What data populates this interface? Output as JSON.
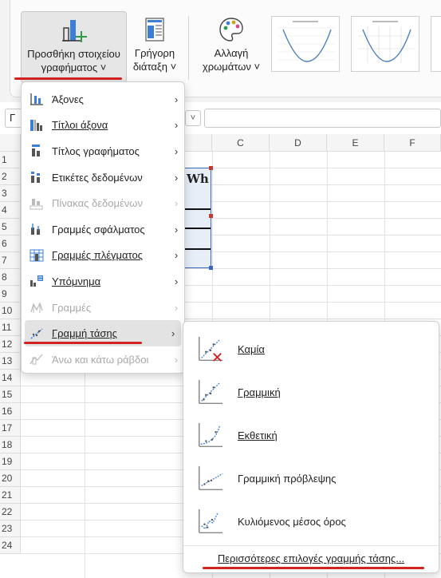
{
  "ribbon": {
    "add_element_line1": "Προσθήκη στοιχείου",
    "add_element_line2": "γραφήματος ˅",
    "quick_layout_line1": "Γρήγορη",
    "quick_layout_line2": "διάταξη ˅",
    "change_colors_line1": "Αλλαγή",
    "change_colors_line2": "χρωμάτων ˅",
    "accent_color": "#d32222"
  },
  "formula_bar": {
    "name_box": "Γ",
    "chevron": "˅"
  },
  "grid": {
    "columns": [
      "C",
      "D",
      "E",
      "F"
    ],
    "rows": [
      "1",
      "2",
      "3",
      "4",
      "5",
      "6",
      "7",
      "8",
      "9",
      "10",
      "11",
      "12",
      "13",
      "14",
      "15",
      "16",
      "17",
      "18",
      "19",
      "20",
      "21",
      "22",
      "23",
      "24"
    ],
    "cell_text": "Wh"
  },
  "menu": {
    "items": [
      {
        "label": "Άξονες",
        "icon": "axes-icon",
        "arrow": "›",
        "disabled": false
      },
      {
        "label": "Τίτλοι άξονα",
        "icon": "axis-titles-icon",
        "arrow": "›",
        "disabled": false
      },
      {
        "label": "Τίτλος γραφήματος",
        "icon": "chart-title-icon",
        "arrow": "›",
        "disabled": false
      },
      {
        "label": "Ετικέτες δεδομένων",
        "icon": "data-labels-icon",
        "arrow": "›",
        "disabled": false
      },
      {
        "label": "Πίνακας δεδομένων",
        "icon": "data-table-icon",
        "arrow": "›",
        "disabled": true
      },
      {
        "label": "Γραμμές σφάλματος",
        "icon": "error-bars-icon",
        "arrow": "›",
        "disabled": false
      },
      {
        "label": "Γραμμές πλέγματος",
        "icon": "gridlines-icon",
        "arrow": "›",
        "disabled": false
      },
      {
        "label": "Υπόμνημα",
        "icon": "legend-icon",
        "arrow": "›",
        "disabled": false
      },
      {
        "label": "Γραμμές",
        "icon": "lines-icon",
        "arrow": "›",
        "disabled": true
      },
      {
        "label": "Γραμμή τάσης",
        "icon": "trendline-icon",
        "arrow": "›",
        "disabled": false
      },
      {
        "label": "Άνω και κάτω ράβδοι",
        "icon": "up-down-bars-icon",
        "arrow": "›",
        "disabled": true
      }
    ]
  },
  "submenu": {
    "items": [
      {
        "label": "Καμία",
        "icon": "trendline-none-icon"
      },
      {
        "label": "Γραμμική",
        "icon": "trendline-linear-icon"
      },
      {
        "label": "Εκθετική",
        "icon": "trendline-exponential-icon"
      },
      {
        "label": "Γραμμική πρόβλεψης",
        "icon": "trendline-linear-forecast-icon"
      },
      {
        "label": "Κυλιόμενος μέσος όρος",
        "icon": "trendline-moving-average-icon"
      }
    ],
    "more_label": "Περισσότερες επιλογές γραμμής τάσης..."
  }
}
